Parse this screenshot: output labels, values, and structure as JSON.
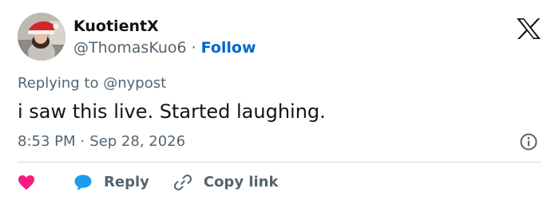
{
  "user": {
    "display_name": "KuotientX",
    "handle": "@ThomasKuo6",
    "separator": "·",
    "follow_label": "Follow"
  },
  "reply_context": {
    "prefix": "Replying to",
    "mention": "@nypost"
  },
  "tweet": {
    "text": "i saw this live. Started laughing.",
    "time": "8:53 PM",
    "separator": "·",
    "date": "Sep 28, 2026"
  },
  "actions": {
    "reply_label": "Reply",
    "copy_link_label": "Copy link"
  },
  "icons": {
    "logo": "x-logo-icon",
    "info": "info-icon",
    "like": "heart-icon",
    "reply": "speech-bubble-icon",
    "copy_link": "link-icon"
  },
  "colors": {
    "primary_text": "#0f1419",
    "secondary_text": "#536471",
    "follow_blue": "#0067c9",
    "like_pink": "#f91880",
    "reply_blue": "#1d9bf0",
    "divider": "#cfd9de"
  }
}
